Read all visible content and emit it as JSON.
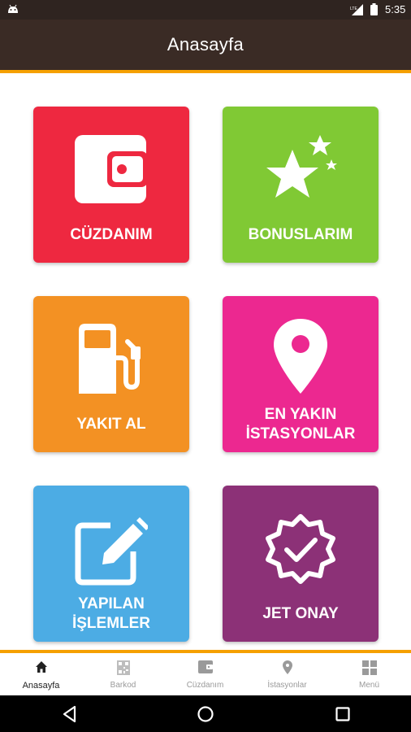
{
  "status_bar": {
    "time": "5:35",
    "network": "LTE"
  },
  "app_bar": {
    "title": "Anasayfa"
  },
  "tiles": [
    {
      "label": "CÜZDANIM",
      "icon": "wallet-icon",
      "color": "#ee2840"
    },
    {
      "label": "BONUSLARIM",
      "icon": "stars-icon",
      "color": "#80c934"
    },
    {
      "label": "YAKIT AL",
      "icon": "fuel-pump-icon",
      "color": "#f39123"
    },
    {
      "label_line1": "EN YAKIN",
      "label_line2": "İSTASYONLAR",
      "icon": "location-pin-icon",
      "color": "#ec2890"
    },
    {
      "label_line1": "YAPILAN",
      "label_line2": "İŞLEMLER",
      "icon": "edit-icon",
      "color": "#4cace4"
    },
    {
      "label": "JET ONAY",
      "icon": "verified-badge-icon",
      "color": "#8c3177"
    }
  ],
  "bottom_nav": [
    {
      "label": "Anasayfa",
      "icon": "home-icon",
      "active": true
    },
    {
      "label": "Barkod",
      "icon": "qr-code-icon"
    },
    {
      "label": "Cüzdanım",
      "icon": "wallet-icon"
    },
    {
      "label": "İstasyonlar",
      "icon": "location-pin-icon"
    },
    {
      "label": "Menü",
      "icon": "grid-menu-icon"
    }
  ],
  "colors": {
    "app_bar": "#3a2b25",
    "accent": "#f5a000",
    "nav_active": "#222222",
    "nav_inactive": "#9a9a9a"
  }
}
